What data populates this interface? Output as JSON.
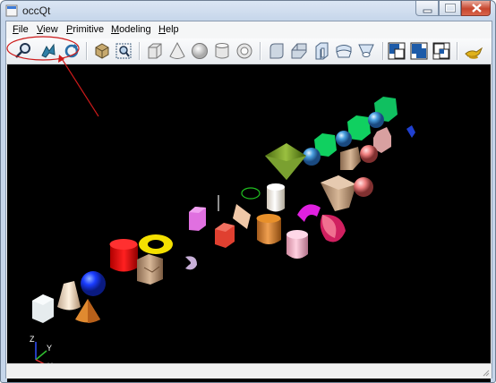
{
  "window": {
    "title": "occQt",
    "controls": [
      "minimize-icon",
      "maximize-icon",
      "close-icon"
    ]
  },
  "menubar": {
    "items": [
      {
        "label": "File",
        "mnemonic": "F",
        "rest": "ile"
      },
      {
        "label": "View",
        "mnemonic": "V",
        "rest": "iew"
      },
      {
        "label": "Primitive",
        "mnemonic": "P",
        "rest": "rimitive"
      },
      {
        "label": "Modeling",
        "mnemonic": "M",
        "rest": "odeling"
      },
      {
        "label": "Help",
        "mnemonic": "H",
        "rest": "elp"
      }
    ]
  },
  "toolbar": {
    "view_tools": [
      "zoom-icon",
      "pan-icon",
      "rotate-icon"
    ],
    "display_tools": [
      "reset-view-icon",
      "fit-all-icon"
    ],
    "primitive_tools": [
      "box-icon",
      "cone-icon",
      "sphere-icon",
      "cylinder-icon",
      "torus-icon"
    ],
    "modeling_tools": [
      "fillet-icon",
      "chamfer-icon",
      "extrude-icon",
      "revolve-icon",
      "loft-icon"
    ],
    "boolean_tools": [
      "cut-icon",
      "fuse-icon",
      "common-icon"
    ],
    "help_tools": [
      "about-icon"
    ]
  },
  "axis_triad": {
    "x": "X",
    "y": "Y",
    "z": "Z"
  },
  "colors": {
    "viewport_bg": "#000000",
    "annotation": "#cc1a1a",
    "axis_x": "#e03030",
    "axis_y": "#30c030",
    "axis_z": "#3050ff"
  }
}
